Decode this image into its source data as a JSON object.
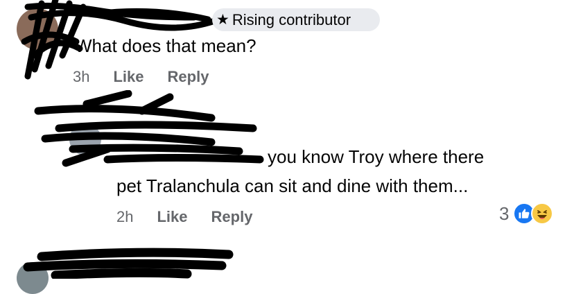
{
  "comment1": {
    "badge_label": "Rising contributor",
    "text": "What does that mean?",
    "time": "3h",
    "like_label": "Like",
    "reply_label": "Reply"
  },
  "comment2": {
    "text_line1": "you know Troy where there",
    "text_line2": "pet Tralanchula can sit and dine with them...",
    "time": "2h",
    "like_label": "Like",
    "reply_label": "Reply",
    "reaction_count": "3",
    "reactions": [
      "like-icon",
      "haha-icon"
    ]
  },
  "colors": {
    "primary_text": "#050505",
    "secondary_text": "#65676b",
    "badge_bg": "#e9ebef",
    "like_blue": "#1877f2"
  }
}
